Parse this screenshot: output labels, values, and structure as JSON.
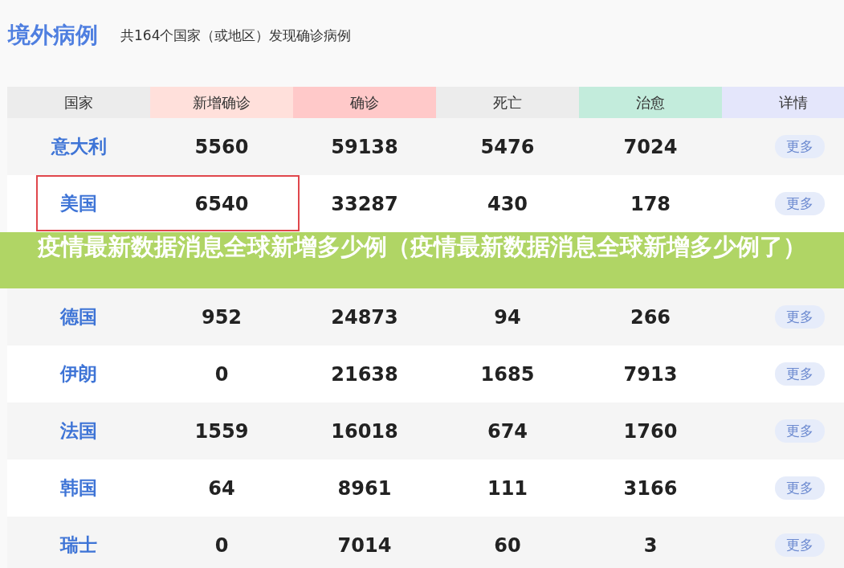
{
  "heading": {
    "title": "境外病例",
    "subtitle": "共164个国家（或地区）发现确诊病例"
  },
  "table": {
    "columns": [
      "国家",
      "新增确诊",
      "确诊",
      "死亡",
      "治愈",
      "详情"
    ],
    "rows": [
      {
        "country": "意大利",
        "new": "5560",
        "confirmed": "59138",
        "deaths": "5476",
        "cured": "7024",
        "action": "更多",
        "highlighted": false
      },
      {
        "country": "美国",
        "new": "6540",
        "confirmed": "33287",
        "deaths": "430",
        "cured": "178",
        "action": "更多",
        "highlighted": true
      },
      {
        "country": "德国",
        "new": "952",
        "confirmed": "24873",
        "deaths": "94",
        "cured": "266",
        "action": "更多",
        "highlighted": false
      },
      {
        "country": "伊朗",
        "new": "0",
        "confirmed": "21638",
        "deaths": "1685",
        "cured": "7913",
        "action": "更多",
        "highlighted": false
      },
      {
        "country": "法国",
        "new": "1559",
        "confirmed": "16018",
        "deaths": "674",
        "cured": "1760",
        "action": "更多",
        "highlighted": false
      },
      {
        "country": "韩国",
        "new": "64",
        "confirmed": "8961",
        "deaths": "111",
        "cured": "3166",
        "action": "更多",
        "highlighted": false
      },
      {
        "country": "瑞士",
        "new": "0",
        "confirmed": "7014",
        "deaths": "60",
        "cured": "3",
        "action": "更多",
        "highlighted": false
      }
    ]
  },
  "banner": {
    "text": "疫情最新数据消息全球新增多少例（疫情最新数据消息全球新增多少例了）"
  }
}
